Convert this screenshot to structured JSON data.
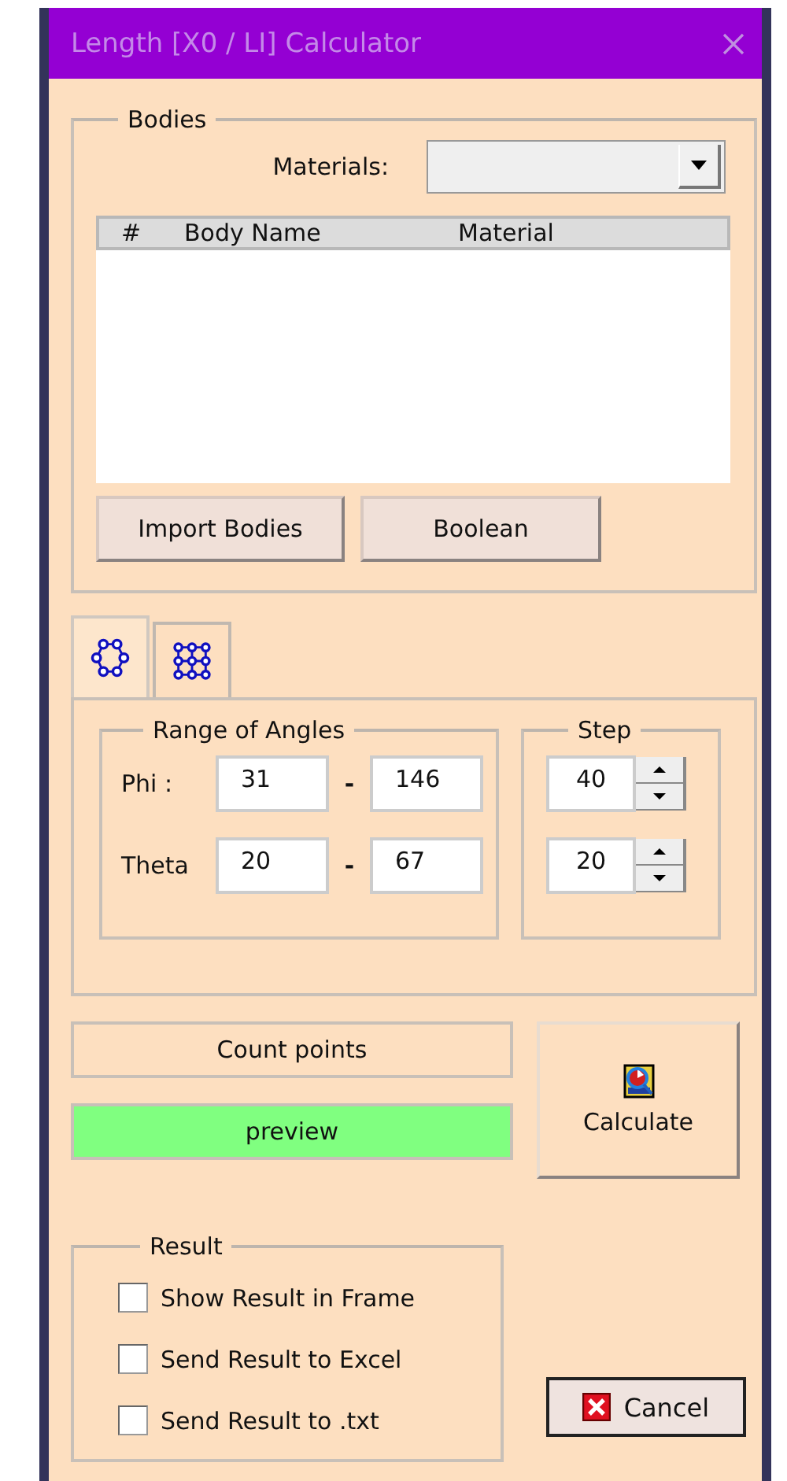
{
  "window": {
    "title": "Length [X0 / LI]  Calculator"
  },
  "bodies": {
    "title": "Bodies",
    "materials_label": "Materials:",
    "columns": [
      "#",
      "Body Name",
      "Material"
    ],
    "buttons": [
      "Import Bodies",
      "Boolean"
    ]
  },
  "tabs": [
    {
      "kind": "ring",
      "selected": true
    },
    {
      "kind": "grid",
      "selected": false
    }
  ],
  "angles": {
    "title": "Range of Angles",
    "rows": [
      {
        "label": "Phi :",
        "from": "31",
        "to": "146",
        "step": "40"
      },
      {
        "label": "Theta",
        "from": "20",
        "to": "67",
        "step": "20"
      }
    ],
    "separator": "-"
  },
  "step": {
    "title": "Step"
  },
  "count_button": "Count points",
  "preview_button": {
    "label": "preview",
    "highlighted": true
  },
  "calculate_button": "Calculate",
  "result": {
    "title": "Result",
    "options": [
      {
        "label": "Show Result in Frame",
        "checked": false
      },
      {
        "label": "Send Result to Excel",
        "checked": false
      },
      {
        "label": "Send Result to .txt",
        "checked": false
      }
    ]
  },
  "cancel_button": "Cancel"
}
